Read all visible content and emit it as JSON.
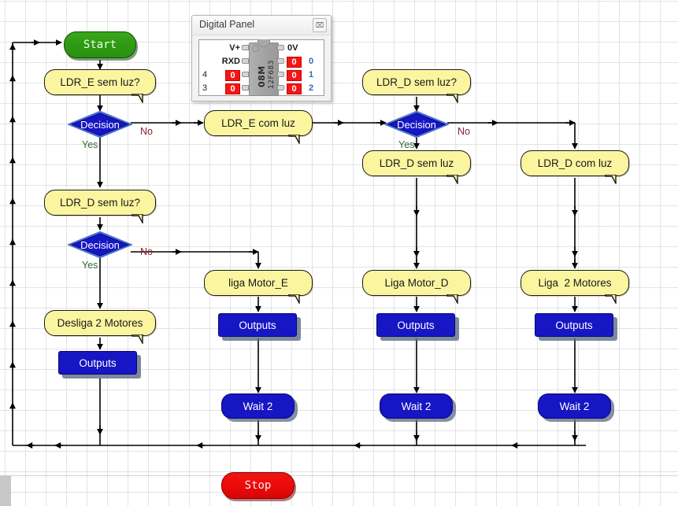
{
  "app": {
    "canvas_name": "flowchart-canvas"
  },
  "digital_panel": {
    "title": "Digital Panel",
    "close_label": "⌧",
    "chip": {
      "name": "08M",
      "part": "12F683"
    },
    "top_left_label": "V+",
    "top_right_label": "0V",
    "rows": [
      {
        "left_label": "RXD",
        "left_value": null,
        "right_value": "0",
        "index": "0"
      },
      {
        "left_label": "4",
        "left_value": "0",
        "right_value": "0",
        "index": "1"
      },
      {
        "left_label": "3",
        "left_value": "0",
        "right_value": "0",
        "index": "2"
      }
    ]
  },
  "flow": {
    "nodes": {
      "start": "Start",
      "stop": "Stop",
      "ldr_e_sem_luz_q": "LDR_E sem luz?",
      "ldr_d_sem_luz_q_left": "LDR_D sem luz?",
      "ldr_d_sem_luz_q_right": "LDR_D sem luz?",
      "decision_1": "Decision",
      "decision_2": "Decision",
      "decision_3": "Decision",
      "ldr_e_com_luz": "LDR_E com luz",
      "ldr_d_sem_luz": "LDR_D sem luz",
      "ldr_d_com_luz": "LDR_D com luz",
      "desliga_2_motores": "Desliga 2 Motores",
      "liga_motor_e": "liga Motor_E",
      "liga_motor_d": "Liga Motor_D",
      "liga_2_motores": "Liga  2 Motores",
      "outputs_1": "Outputs",
      "outputs_2": "Outputs",
      "outputs_3": "Outputs",
      "outputs_4": "Outputs",
      "wait_1": "Wait 2",
      "wait_2": "Wait 2",
      "wait_3": "Wait 2"
    },
    "edges": {
      "yes_1": "Yes",
      "no_1": "No",
      "yes_2": "Yes",
      "no_2": "No",
      "yes_3": "Yes",
      "no_3": "No"
    }
  },
  "colors": {
    "start_green": "#2f9a14",
    "stop_red": "#ec0b0b",
    "process_yellow": "#fbf5a0",
    "decision_blue": "#1616c4",
    "output_blue": "#1616c4",
    "yes_label": "#2f6b37",
    "no_label": "#8e2030",
    "panel_value_red": "#f41616",
    "panel_index_blue": "#2b6cb7"
  }
}
